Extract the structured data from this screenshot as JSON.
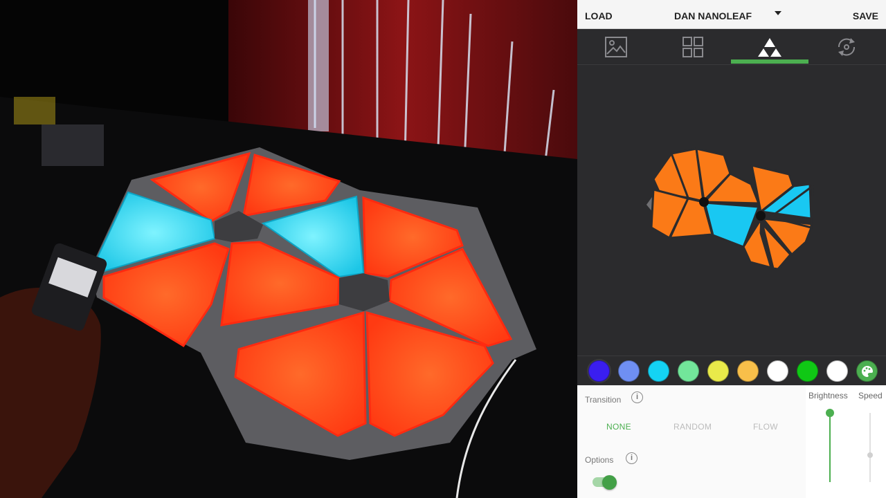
{
  "photo": {
    "description_icon": "nanoleaf-panels-photo"
  },
  "topbar": {
    "load_label": "LOAD",
    "profile_name": "DAN NANOLEAF",
    "save_label": "SAVE"
  },
  "tabs": [
    {
      "icon": "image-icon",
      "selected": false
    },
    {
      "icon": "grid-icon",
      "selected": false
    },
    {
      "icon": "triangles-icon",
      "selected": true
    },
    {
      "icon": "rotate-icon",
      "selected": false
    }
  ],
  "palette": {
    "colors": [
      "#3a1ef0",
      "#6f8ff3",
      "#14d3f4",
      "#72e69a",
      "#e9ea4a",
      "#f8bf4a",
      "#ffffff",
      "#10c815",
      "#ffffff"
    ],
    "custom_icon": "palette-icon",
    "accent": "#4caf50",
    "panel_orange": "#fb7a17",
    "panel_cyan": "#19c8f2"
  },
  "transition": {
    "label": "Transition",
    "info_icon": "i",
    "options": [
      "NONE",
      "RANDOM",
      "FLOW"
    ],
    "selected": "NONE"
  },
  "options": {
    "label": "Options",
    "info_icon": "i",
    "toggle_on": true
  },
  "brightness": {
    "label": "Brightness",
    "value_fraction": 1.0
  },
  "speed": {
    "label": "Speed",
    "value_fraction": 0.37
  }
}
